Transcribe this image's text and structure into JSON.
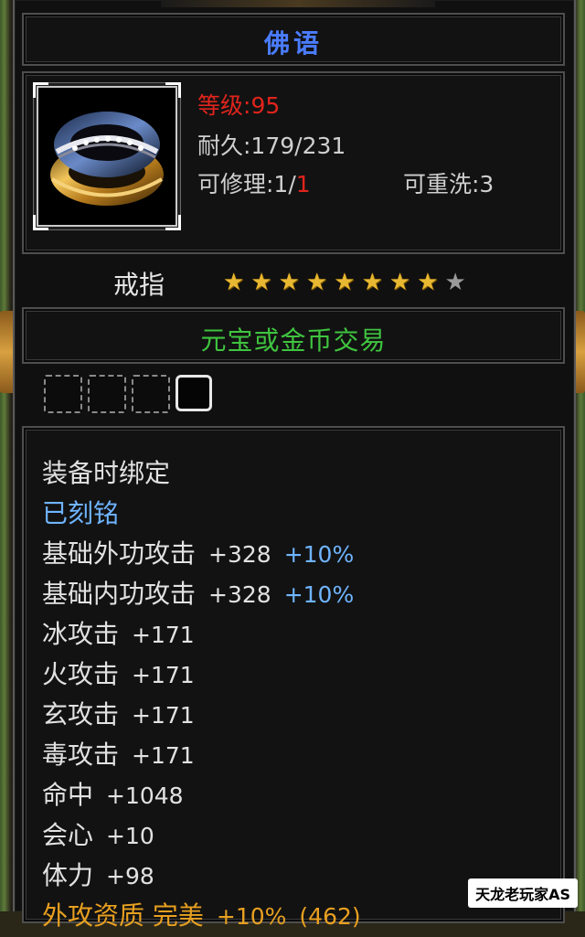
{
  "item": {
    "name": "佛语",
    "level_label": "等级:",
    "level_value": "95",
    "durability": "耐久:179/231",
    "repair_label": "可修理:1/",
    "repair_value": "1",
    "rewash": "可重洗:3",
    "type": "戒指",
    "stars_filled": 8,
    "stars_total": 9
  },
  "trade": "元宝或金币交易",
  "sockets": {
    "empty": 3,
    "filled": 1
  },
  "colors": {
    "title": "#4a7cff",
    "trade": "#3fc43f",
    "level": "#e0241c",
    "percent": "#6fb4ff",
    "star": "#e8b832"
  },
  "attributes": [
    {
      "label": "装备时绑定",
      "value": "",
      "percent": "",
      "style": "plain"
    },
    {
      "label": "已刻铭",
      "value": "",
      "percent": "",
      "style": "engraved"
    },
    {
      "label": "基础外功攻击",
      "value": "+328",
      "percent": "+10%",
      "style": "plain"
    },
    {
      "label": "基础内功攻击",
      "value": "+328",
      "percent": "+10%",
      "style": "plain"
    },
    {
      "label": "冰攻击",
      "value": "+171",
      "percent": "",
      "style": "plain"
    },
    {
      "label": "火攻击",
      "value": "+171",
      "percent": "",
      "style": "plain"
    },
    {
      "label": "玄攻击",
      "value": "+171",
      "percent": "",
      "style": "plain"
    },
    {
      "label": "毒攻击",
      "value": "+171",
      "percent": "",
      "style": "plain"
    },
    {
      "label": "命中",
      "value": "+1048",
      "percent": "",
      "style": "plain"
    },
    {
      "label": "会心",
      "value": "+10",
      "percent": "",
      "style": "plain"
    },
    {
      "label": "体力",
      "value": "+98",
      "percent": "",
      "style": "plain"
    },
    {
      "label": "外攻资质 完美",
      "value": "+10%",
      "percent": "(462)",
      "style": "plain"
    }
  ],
  "watermark": "天龙老玩家AS"
}
